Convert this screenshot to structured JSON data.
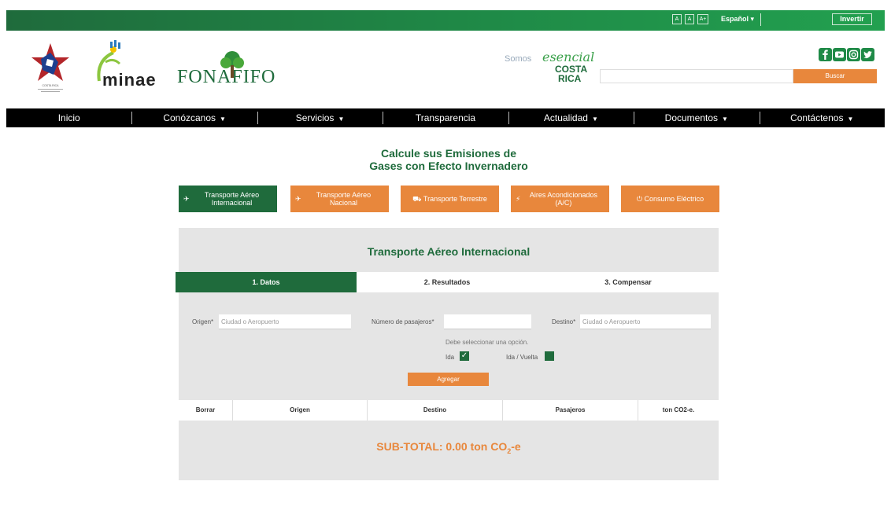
{
  "topbar": {
    "a11y_buttons": [
      "A",
      "A",
      "A+"
    ],
    "language": "Español",
    "invertir": "Invertir"
  },
  "header": {
    "logos": {
      "costa_rica_seal": "COSTA RICA",
      "minae": "minae",
      "fonafifo": "FONAFIFO",
      "esencial_somos": "Somos",
      "esencial_word": "esencial",
      "esencial_costa": "COSTA",
      "esencial_rica": "RICA"
    },
    "search_placeholder": "",
    "search_button": "Buscar",
    "social_icons": [
      "facebook-icon",
      "youtube-icon",
      "instagram-icon",
      "twitter-icon"
    ]
  },
  "nav": [
    {
      "label": "Inicio",
      "dropdown": false
    },
    {
      "label": "Conózcanos",
      "dropdown": true
    },
    {
      "label": "Servicios",
      "dropdown": true
    },
    {
      "label": "Transparencia",
      "dropdown": false
    },
    {
      "label": "Actualidad",
      "dropdown": true
    },
    {
      "label": "Documentos",
      "dropdown": true
    },
    {
      "label": "Contáctenos",
      "dropdown": true
    }
  ],
  "title_line1": "Calcule sus Emisiones de",
  "title_line2": "Gases con Efecto Invernadero",
  "categories": [
    {
      "icon": "plane-icon",
      "label": "Transporte Aéreo Internacional",
      "active": true
    },
    {
      "icon": "plane-icon",
      "label": "Transporte Aéreo Nacional",
      "active": false
    },
    {
      "icon": "car-icon",
      "label": "Transporte Terrestre",
      "active": false
    },
    {
      "icon": "bolt-icon",
      "label": "Aires Acondicionados (A/C)",
      "active": false
    },
    {
      "icon": "plug-icon",
      "label": "Consumo Eléctrico",
      "active": false
    }
  ],
  "panel": {
    "title": "Transporte Aéreo Internacional",
    "steps": [
      "1. Datos",
      "2. Resultados",
      "3. Compensar"
    ],
    "origen_label": "Origen*",
    "origen_placeholder": "Ciudad o Aeropuerto",
    "pasajeros_label": "Número de pasajeros*",
    "pasajeros_value": "",
    "destino_label": "Destino*",
    "destino_placeholder": "Ciudad o Aeropuerto",
    "option_hint": "Debe seleccionar una opción.",
    "ida_label": "Ida",
    "ida_checked": true,
    "idavuelta_label": "Ida / Vuelta",
    "idavuelta_checked": false,
    "add_button": "Agregar",
    "table_headers": [
      "Borrar",
      "Origen",
      "Destino",
      "Pasajeros",
      "ton CO2-e."
    ],
    "subtotal_prefix": "SUB-TOTAL: 0.00 ton CO",
    "subtotal_sub": "2",
    "subtotal_suffix": "-e"
  }
}
